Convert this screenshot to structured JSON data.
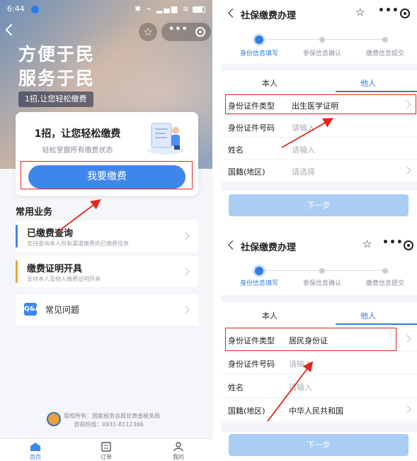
{
  "left": {
    "status_time": "6:44",
    "hero": {
      "slogan_line1": "方便于民",
      "slogan_line2": "服务于民",
      "badge": "1招,让您轻松缴费"
    },
    "pay_card": {
      "title": "1招，让您轻松缴费",
      "subtitle": "轻松掌握所有缴费状态",
      "button": "我要缴费"
    },
    "section_title": "常用业务",
    "business": [
      {
        "name": "已缴费查询",
        "desc": "支持查询本人所有渠道缴费的已缴费信息",
        "bar_color": "#3f86ea"
      },
      {
        "name": "缴费证明开具",
        "desc": "支持本人及他人缴费证明开具",
        "bar_color": "#f0a23a"
      }
    ],
    "faq": {
      "icon_text": "Q&A",
      "name": "常见问题"
    },
    "footer": {
      "line1": "版权所有：国家税务总局甘肃省税务局",
      "line2": "咨询热线：0931-8112366"
    },
    "tabs": [
      {
        "label": "首页",
        "icon": "home-icon",
        "active": true
      },
      {
        "label": "订单",
        "icon": "order-icon",
        "active": false
      },
      {
        "label": "我的",
        "icon": "user-icon",
        "active": false
      }
    ]
  },
  "right_top": {
    "title": "社保缴费办理",
    "steps": [
      "身份信息填写",
      "参保信息确认",
      "缴费信息提交"
    ],
    "segments": [
      "本人",
      "他人"
    ],
    "active_segment": "他人",
    "fields": [
      {
        "label": "身份证件类型",
        "value": "出生医学证明",
        "placeholder": false,
        "chevron": true
      },
      {
        "label": "身份证件号码",
        "value": "请输入",
        "placeholder": true,
        "chevron": false
      },
      {
        "label": "姓名",
        "value": "请输入",
        "placeholder": true,
        "chevron": false
      },
      {
        "label": "国籍(地区)",
        "value": "请选择",
        "placeholder": true,
        "chevron": true
      }
    ],
    "next_button": "下一步"
  },
  "right_bottom": {
    "title": "社保缴费办理",
    "steps": [
      "身份信息填写",
      "参保信息确认",
      "缴费信息提交"
    ],
    "segments": [
      "本人",
      "他人"
    ],
    "active_segment": "他人",
    "fields": [
      {
        "label": "身份证件类型",
        "value": "居民身份证",
        "placeholder": false,
        "chevron": true
      },
      {
        "label": "身份证件号码",
        "value": "请输入",
        "placeholder": true,
        "chevron": false
      },
      {
        "label": "姓名",
        "value": "请输入",
        "placeholder": true,
        "chevron": false
      },
      {
        "label": "国籍(地区)",
        "value": "中华人民共和国",
        "placeholder": false,
        "chevron": true
      }
    ],
    "next_button": "下一步"
  },
  "colors": {
    "primary": "#3f86ea",
    "highlight": "#e2261c",
    "disabled_button": "#a9cdf5"
  }
}
